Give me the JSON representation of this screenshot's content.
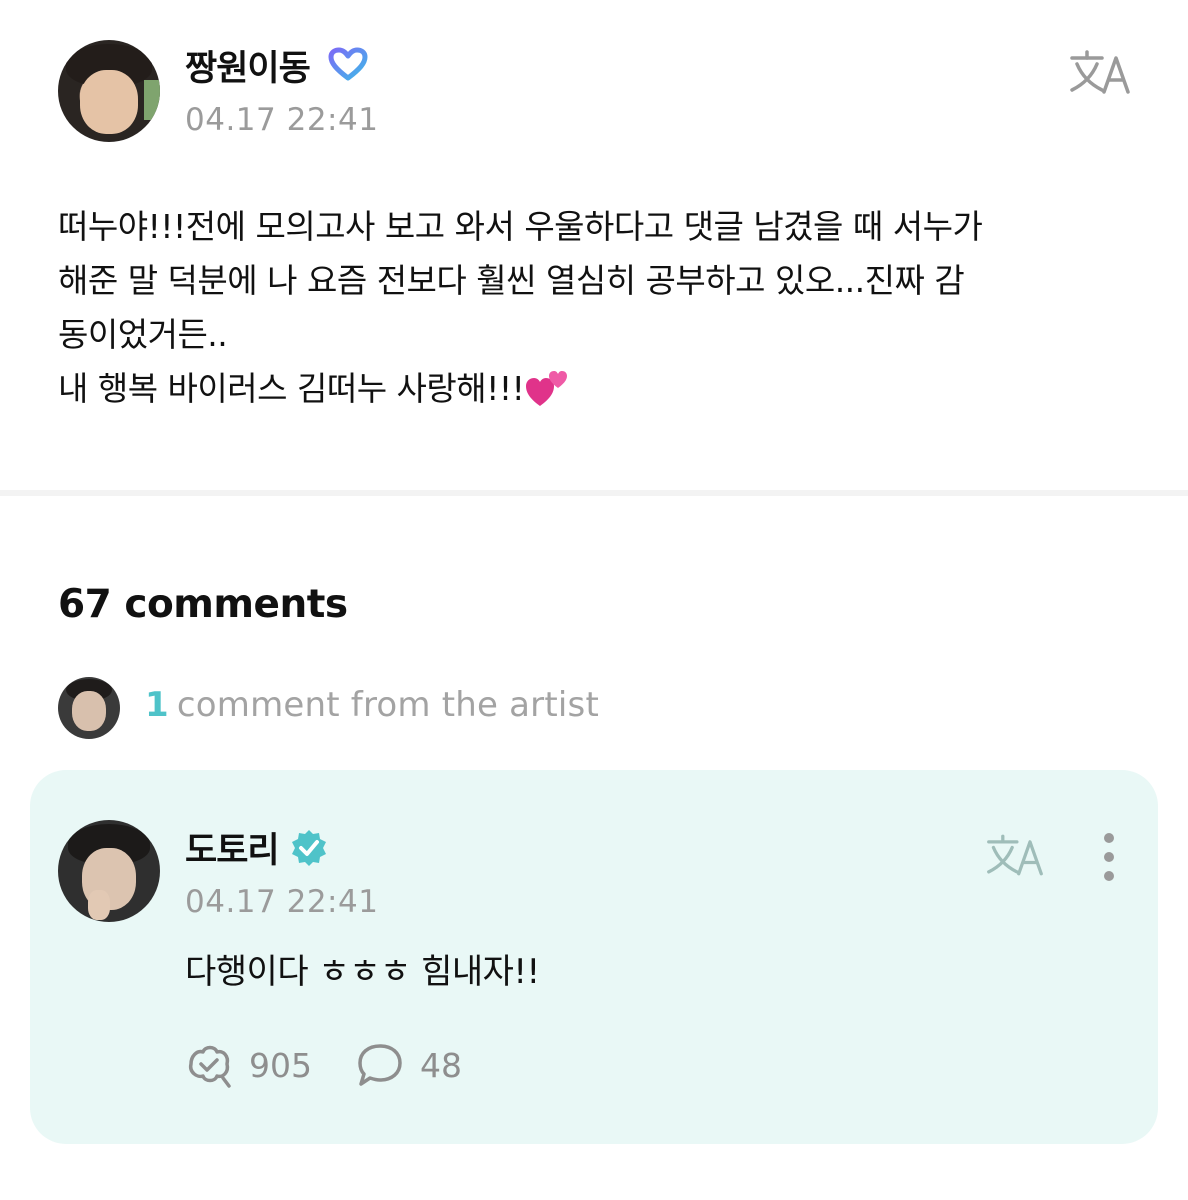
{
  "post": {
    "author": "짱원이동",
    "date": "04.17 22:41",
    "body_lines": [
      "떠누야!!!전에 모의고사 보고 와서 우울하다고 댓글 남겼을 때 서누가",
      "해준 말 덕분에 나 요즘 전보다 훨씬 열심히 공부하고 있오...진짜 감",
      "동이었거든..",
      "내 행복 바이러스 김떠누 사랑해!!!"
    ]
  },
  "comments": {
    "count_label": "67 comments",
    "artist_count": "1",
    "artist_label": "comment from the artist"
  },
  "artist_comment": {
    "author": "도토리",
    "date": "04.17 22:41",
    "text": "다행이다 ㅎㅎㅎ 힘내자!!",
    "likes": "905",
    "replies": "48"
  },
  "colors": {
    "accent_teal": "#4fc3c9",
    "card_bg": "#e9f8f6",
    "muted_text": "#9b9b9b"
  },
  "icons": {
    "translate": "translate-icon",
    "verified": "verified-badge-icon",
    "heart": "two-hearts-emoji",
    "like": "like-icon",
    "reply": "reply-bubble-icon",
    "more": "more-vertical-icon"
  }
}
